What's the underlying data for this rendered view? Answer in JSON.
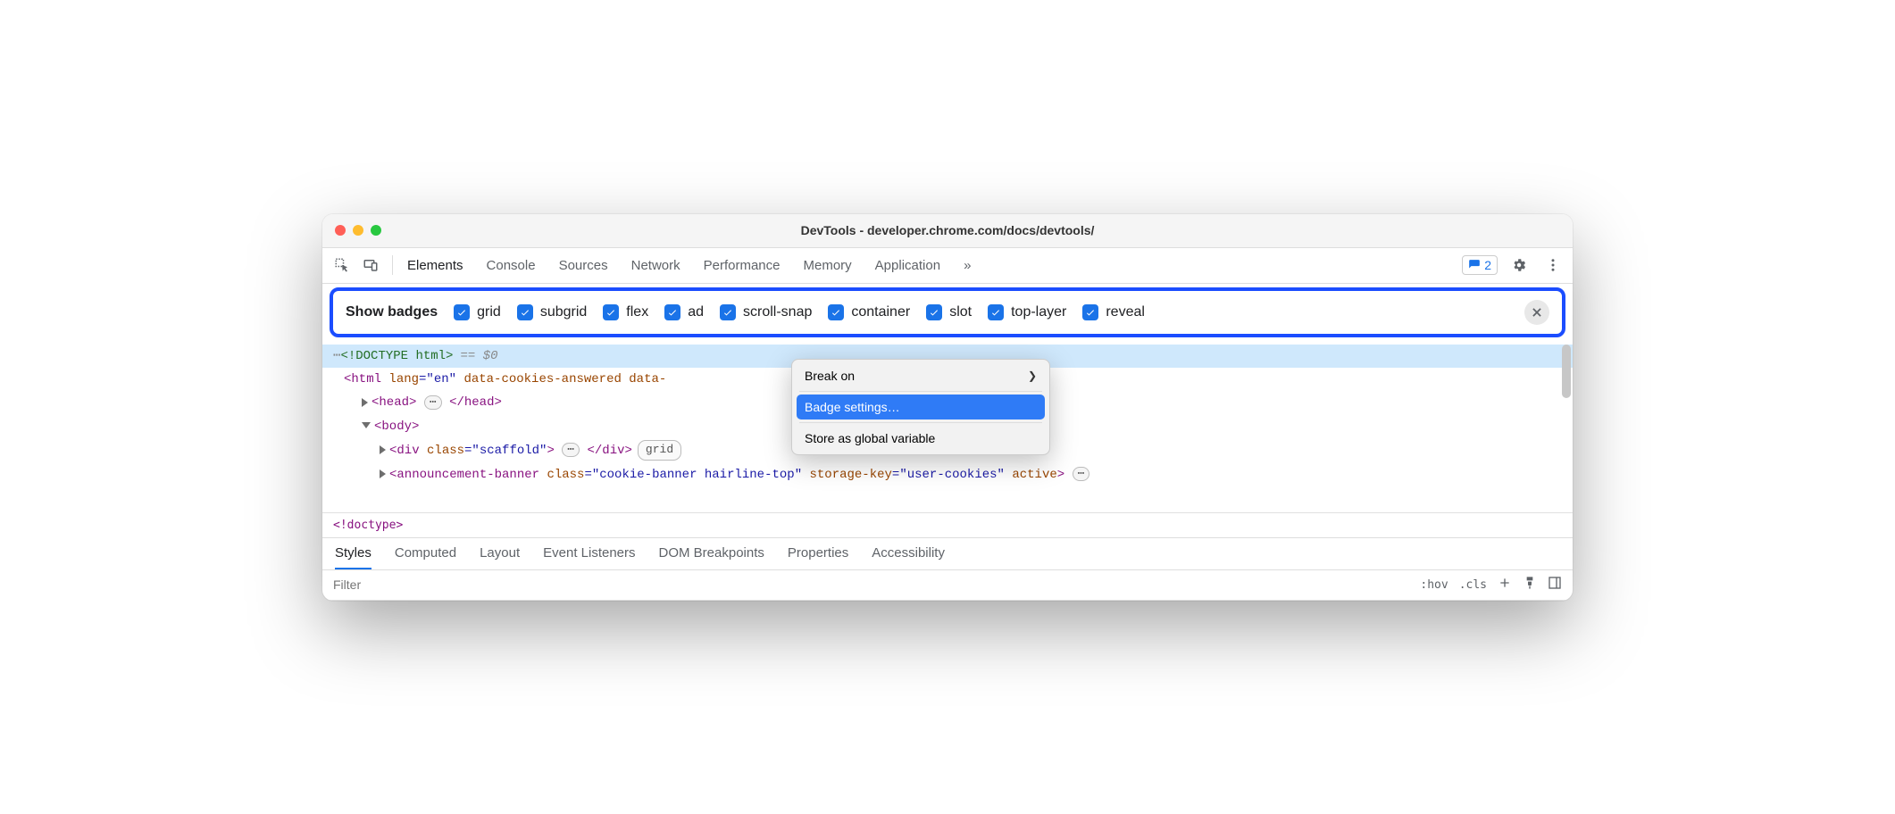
{
  "window_title": "DevTools - developer.chrome.com/docs/devtools/",
  "toolbar": {
    "tabs": [
      "Elements",
      "Console",
      "Sources",
      "Network",
      "Performance",
      "Memory",
      "Application"
    ],
    "active_tab": "Elements",
    "overflow": "»",
    "issues_count": "2"
  },
  "badge_bar": {
    "title": "Show badges",
    "items": [
      "grid",
      "subgrid",
      "flex",
      "ad",
      "scroll-snap",
      "container",
      "slot",
      "top-layer",
      "reveal"
    ]
  },
  "dom": {
    "line0_dots": "⋯",
    "line0": "<!DOCTYPE html>",
    "line0_suffix": "== $0",
    "line1_open": "<html ",
    "line1_attr1_name": "lang",
    "line1_attr1_val": "=\"en\"",
    "line1_attr2": " data-cookies-answered data-",
    "line2_head_open": "<head>",
    "line2_ellipsis": "⋯",
    "line2_head_close": "</head>",
    "line3_body": "<body>",
    "line4_div_open": "<div ",
    "line4_class_name": "class",
    "line4_class_val": "=\"scaffold\"",
    "line4_div_mid": ">",
    "line4_ellipsis": "⋯",
    "line4_div_close": "</div>",
    "line4_badge": "grid",
    "line5_tag_open": "<announcement-banner ",
    "line5_class_name": "class",
    "line5_class_val": "=\"cookie-banner hairline-top\"",
    "line5_sk_name": " storage-key",
    "line5_sk_val": "=\"user-cookies\"",
    "line5_active": " active",
    "line5_end": ">",
    "line5_ellipsis": "⋯"
  },
  "context_menu": {
    "item1": "Break on",
    "item2": "Badge settings…",
    "item3": "Store as global variable"
  },
  "breadcrumb": "<!doctype>",
  "styles_tabs": [
    "Styles",
    "Computed",
    "Layout",
    "Event Listeners",
    "DOM Breakpoints",
    "Properties",
    "Accessibility"
  ],
  "styles_active": "Styles",
  "filter": {
    "placeholder": "Filter",
    "hov": ":hov",
    "cls": ".cls"
  }
}
